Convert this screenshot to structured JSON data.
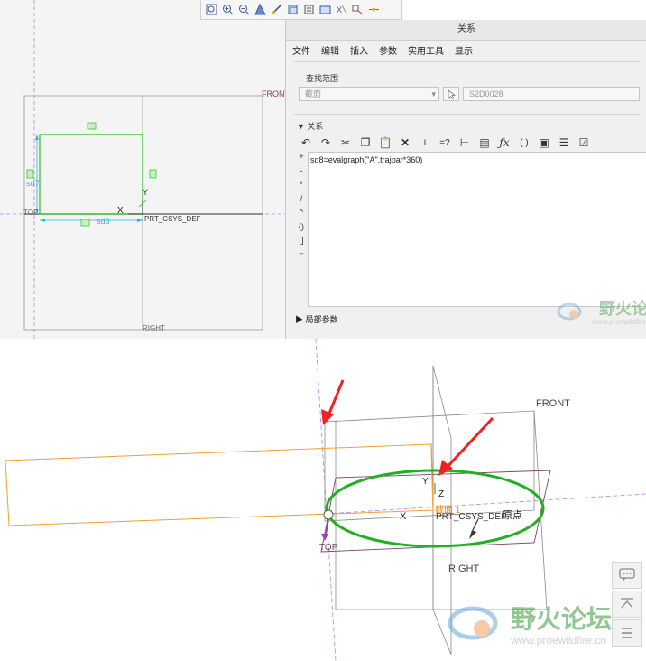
{
  "toolbar": {
    "icons": [
      "refit-icon",
      "zoom-in-icon",
      "zoom-out-icon",
      "repaint-icon",
      "orient-icon",
      "saved-views-icon",
      "display-style-icon",
      "datum-display-icon",
      "sketch-display-icon",
      "annotation-display-icon",
      "spin-center-icon"
    ]
  },
  "sketch": {
    "label_front": "FRONT",
    "label_top": "TOP",
    "label_right": "RIGHT",
    "label_csys": "PRT_CSYS_DEF",
    "label_x": "X",
    "label_y": "Y",
    "dim_sd7": "sd7",
    "dim_sd8": "sd8",
    "colors": {
      "sketch": "#22c022",
      "dimension": "#2db4e6",
      "datum": "#8c8c8c"
    }
  },
  "dialog": {
    "title": "关系",
    "menu": [
      "文件",
      "编辑",
      "插入",
      "参数",
      "实用工具",
      "显示"
    ],
    "scope_title": "查找范围",
    "scope_type": "截面",
    "scope_name": "S2D0028",
    "relations_title": "关系",
    "ops": [
      "+",
      "-",
      "*",
      "/",
      "^",
      "()",
      "[]",
      "="
    ],
    "relation_text": "sd8=evalgraph(\"A\",trajpar*360)",
    "local_params": "局部参数"
  },
  "view3d": {
    "label_front": "FRONT",
    "label_right": "RIGHT",
    "label_top": "TOP",
    "label_csys": "PRT_CSYS_DEF",
    "label_origin": "原点",
    "label_section": "截面 1",
    "label_x": "X",
    "label_y": "Y",
    "label_z": "Z",
    "colors": {
      "trajectory": "#f0a030",
      "ellipse": "#22b022",
      "arrow": "#ee2222",
      "datum": "#7a4060"
    }
  },
  "watermark": {
    "text": "野火论坛",
    "url": "www.proewildfire.cn"
  }
}
